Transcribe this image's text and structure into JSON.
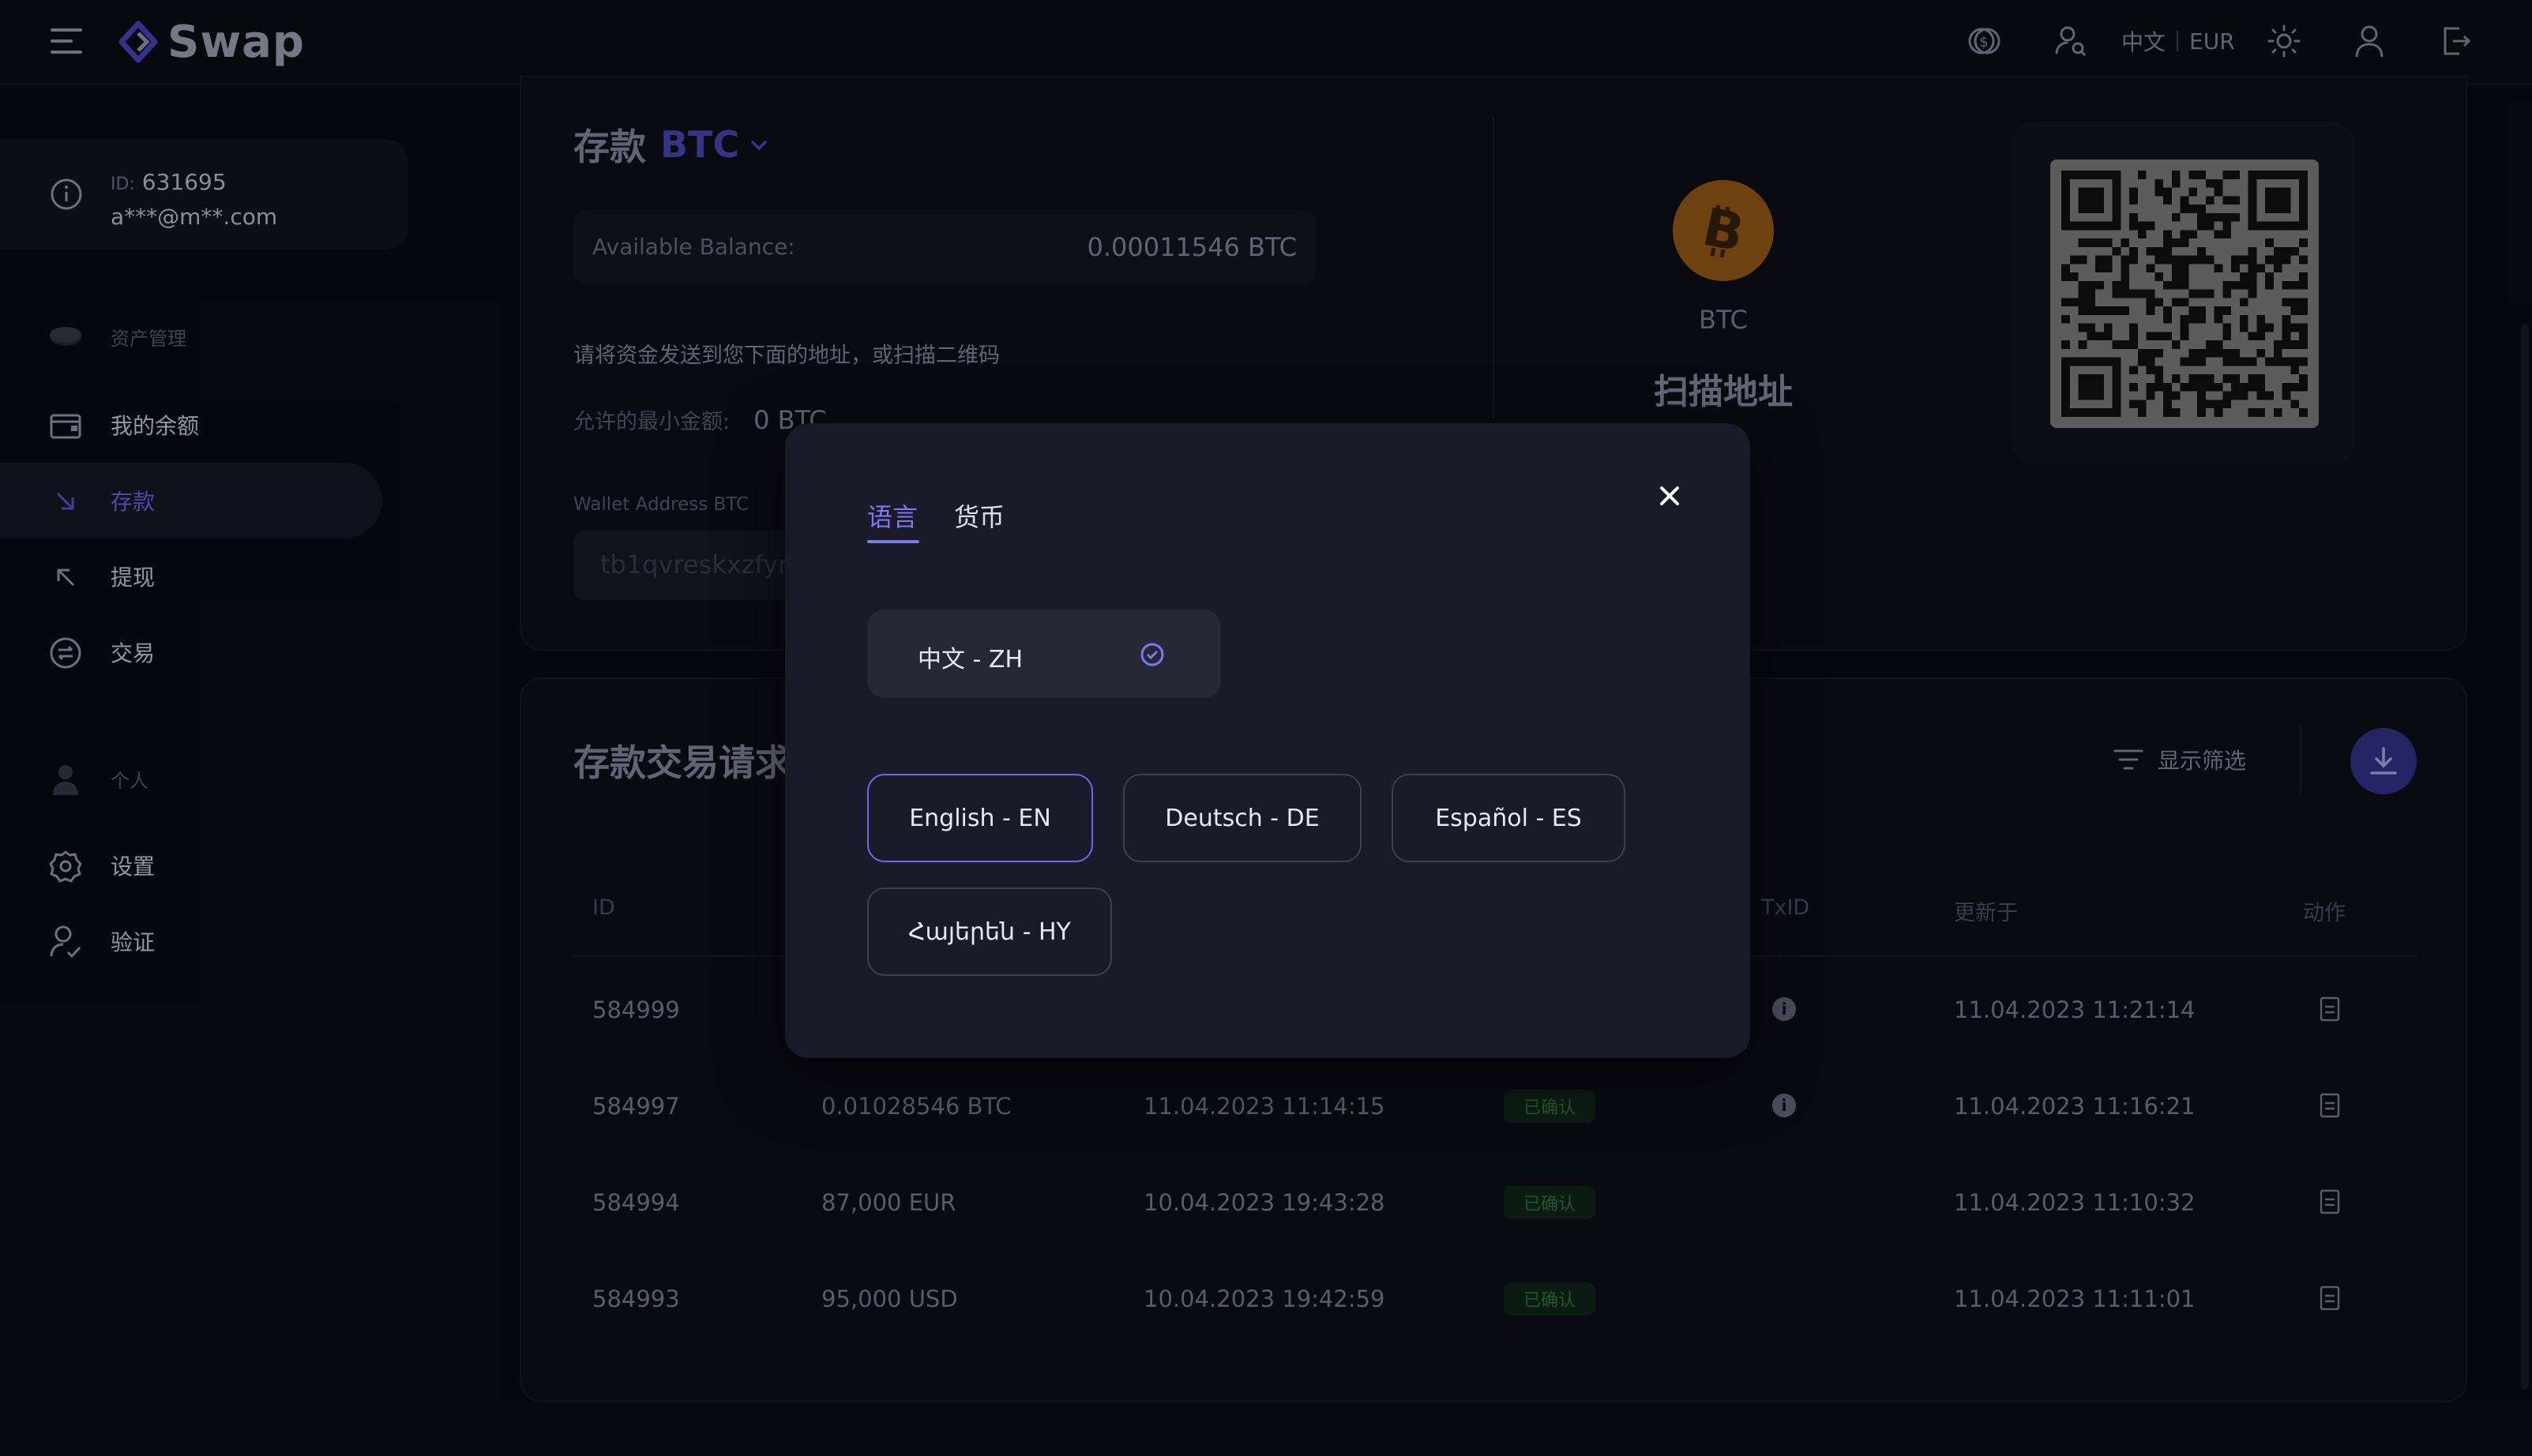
{
  "header": {
    "logo_text": "Swap",
    "lang_label": "中文",
    "currency_label": "EUR"
  },
  "sidebar": {
    "user": {
      "id_prefix": "ID:",
      "id": "631695",
      "email": "a***@m**.com"
    },
    "section_assets": "资产管理",
    "items": [
      {
        "label": "我的余额"
      },
      {
        "label": "存款"
      },
      {
        "label": "提现"
      },
      {
        "label": "交易"
      }
    ],
    "section_personal": "个人",
    "items2": [
      {
        "label": "设置"
      },
      {
        "label": "验证"
      }
    ]
  },
  "deposit": {
    "title": "存款",
    "currency": "BTC",
    "balance_label": "Available Balance:",
    "balance_value": "0.00011546 BTC",
    "hint": "请将资金发送到您下面的地址，或扫描二维码",
    "min_label": "允许的最小金额:",
    "min_value": "0 BTC",
    "wallet_label": "Wallet Address BTC",
    "wallet_value": "tb1qvreskxzfyn",
    "coin_name": "BTC",
    "scan_title": "扫描地址"
  },
  "history": {
    "title": "存款交易请求",
    "filter_label": "显示筛选",
    "columns": {
      "id": "ID",
      "txid": "TxID",
      "updated": "更新于",
      "action": "动作"
    },
    "rows": [
      {
        "id": "584999",
        "amount": "",
        "created": "",
        "status": "",
        "updated": "11.04.2023 11:21:14"
      },
      {
        "id": "584997",
        "amount": "0.01028546 BTC",
        "created": "11.04.2023 11:14:15",
        "status": "已确认",
        "updated": "11.04.2023 11:16:21"
      },
      {
        "id": "584994",
        "amount": "87,000 EUR",
        "created": "10.04.2023 19:43:28",
        "status": "已确认",
        "updated": "11.04.2023 11:10:32"
      },
      {
        "id": "584993",
        "amount": "95,000 USD",
        "created": "10.04.2023 19:42:59",
        "status": "已确认",
        "updated": "11.04.2023 11:11:01"
      }
    ]
  },
  "modal": {
    "tabs": {
      "language": "语言",
      "currency": "货币"
    },
    "current_language": "中文 - ZH",
    "languages": [
      {
        "label": "English - EN"
      },
      {
        "label": "Deutsch - DE"
      },
      {
        "label": "Español - ES"
      },
      {
        "label": "Հայերեն - HY"
      }
    ]
  },
  "colors": {
    "accent": "#7c78ee",
    "background": "#0b0b15",
    "modal": "#1b1a29",
    "bitcoin": "#9a5a18",
    "status_confirmed": "#2d7a45"
  },
  "icons": [
    "menu-icon",
    "logo-icon",
    "coin-icon",
    "user-search-icon",
    "sun-icon",
    "user-icon",
    "logout-icon",
    "info-icon",
    "wallet-icon",
    "deposit-arrow-icon",
    "withdraw-arrow-icon",
    "exchange-icon",
    "person-icon",
    "gear-icon",
    "user-check-icon",
    "chevron-down-icon",
    "bitcoin-icon",
    "filter-icon",
    "download-icon",
    "document-icon",
    "close-icon",
    "check-circle-icon"
  ]
}
